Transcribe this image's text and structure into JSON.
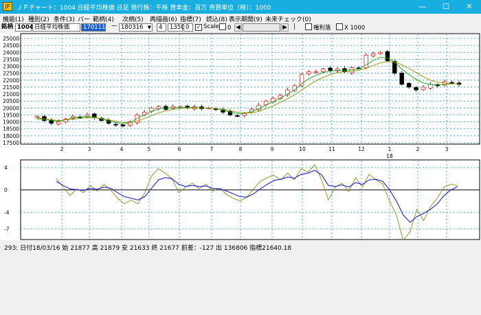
{
  "window": {
    "title": "ＪＰチャート：1004 日経平均株価  日足   発行株：千株  資本金：百万  売買単位（株）：1000",
    "icon_label": "JP",
    "min_icon": "minimize-icon",
    "max_icon": "maximize-icon",
    "close_icon": "close-icon"
  },
  "menu": [
    "機能(1)",
    "種別(2)",
    "条件(3)",
    "バー",
    "範柄(4)",
    "次柄(5)",
    "再描画(6)",
    "指標(7)",
    "読込(8)",
    "表示期間(9)",
    "未来チェック(0)"
  ],
  "toolbar": {
    "label": "銘柄",
    "code": "1004",
    "name": "日経平均株価",
    "date_start": "170111",
    "dash": "一",
    "date_end": "180316",
    "period": "4",
    "value1": "1350",
    "value2": "0",
    "scale_label": "Scale",
    "scale_checked": "✓",
    "zero_label": "0",
    "separator": "|",
    "tick_label": "権利落",
    "x1000_label": "X 1000"
  },
  "chart_data": [
    {
      "type": "candlestick",
      "title": "",
      "ylim": [
        17500,
        25000
      ],
      "yticks": [
        17500,
        18000,
        18500,
        19000,
        19500,
        20000,
        20500,
        21000,
        21500,
        22000,
        22500,
        23000,
        23500,
        24000,
        24500,
        25000
      ],
      "xtick_labels": [
        "2",
        "3",
        "4",
        "5",
        "6",
        "7",
        "8",
        "9",
        "10",
        "11",
        "12",
        "1",
        "2",
        "3"
      ],
      "year_label": "18",
      "grid": true,
      "series": [
        {
          "name": "",
          "values": [
            19400,
            19100,
            18900,
            19000,
            19200,
            19400,
            19350,
            19500,
            19300,
            19100,
            18900,
            18800,
            18700,
            19000,
            19500,
            19700,
            20000,
            20100,
            19900,
            20100,
            20100,
            20000,
            20100,
            19950,
            20000,
            19900,
            19700,
            19500,
            19450,
            19600,
            19900,
            20200,
            20500,
            20700,
            20900,
            21300,
            21600,
            22400,
            22600,
            22600,
            22800,
            22700,
            22800,
            22600,
            22900,
            22850,
            23800,
            23900,
            24000,
            23400,
            22500,
            21700,
            21500,
            21300,
            21500,
            21700,
            21600,
            21900,
            21800,
            21700
          ]
        },
        {
          "name": "",
          "values": [
            19300,
            19200,
            19100,
            19050,
            19150,
            19300,
            19350,
            19400,
            19350,
            19200,
            19050,
            18950,
            18850,
            18950,
            19250,
            19500,
            19750,
            19950,
            20000,
            20000,
            20050,
            20050,
            20050,
            20000,
            20000,
            19950,
            19850,
            19700,
            19600,
            19600,
            19750,
            19950,
            20200,
            20450,
            20700,
            21000,
            21300,
            21750,
            22100,
            22350,
            22550,
            22650,
            22700,
            22700,
            22750,
            22800,
            23100,
            23400,
            23650,
            23600,
            23300,
            22800,
            22400,
            22050,
            21800,
            21700,
            21650,
            21700,
            21750,
            21750
          ]
        },
        {
          "name": "",
          "values": [
            19200,
            19200,
            19150,
            19100,
            19150,
            19200,
            19250,
            19300,
            19300,
            19250,
            19150,
            19050,
            18950,
            18950,
            19050,
            19250,
            19450,
            19650,
            19800,
            19900,
            19950,
            20000,
            20000,
            20000,
            20000,
            19950,
            19900,
            19800,
            19700,
            19650,
            19650,
            19750,
            19950,
            20150,
            20400,
            20650,
            20950,
            21300,
            21650,
            21950,
            22200,
            22400,
            22550,
            22600,
            22650,
            22700,
            22850,
            23050,
            23250,
            23350,
            23300,
            23100,
            22850,
            22550,
            22250,
            22000,
            21850,
            21800,
            21750,
            21750
          ]
        }
      ]
    },
    {
      "type": "line",
      "title": "",
      "ylim": [
        -9,
        5
      ],
      "yticks": [
        4,
        0,
        -4,
        -7
      ],
      "hlines": [
        4,
        0,
        -4,
        -7
      ],
      "grid": true,
      "series": [
        {
          "name": "",
          "values": [
            2,
            0.5,
            -1,
            0.2,
            -0.5,
            0.8,
            -0.2,
            1,
            0,
            -1.5,
            -2.5,
            -1.8,
            -2.5,
            -0.5,
            2.5,
            3.8,
            3,
            2,
            -0.5,
            0.5,
            1.2,
            0.2,
            1,
            -0.2,
            0.3,
            -0.8,
            -1.5,
            -2,
            -1.3,
            0.2,
            1.5,
            2.2,
            2.6,
            1.8,
            3,
            1.8,
            3.8,
            3.2,
            4.5,
            1.8,
            -1.8,
            0.5,
            1.2,
            -0.3,
            2.2,
            0.5,
            2.8,
            1.8,
            1,
            -2,
            -4.5,
            -9,
            -7.5,
            -3.5,
            -5.5,
            -3,
            -1.5,
            0.5,
            1,
            0.8
          ]
        },
        {
          "name": "",
          "values": [
            1.5,
            0.8,
            0.2,
            0,
            -0.1,
            0.3,
            0.1,
            0.5,
            0.3,
            -0.5,
            -1.2,
            -1.5,
            -1.8,
            -1.2,
            0.3,
            1.8,
            2.2,
            2,
            1,
            0.6,
            0.8,
            0.6,
            0.7,
            0.3,
            0.2,
            -0.2,
            -0.7,
            -1.2,
            -1.3,
            -0.7,
            0.2,
            1,
            1.7,
            1.9,
            2.3,
            2.1,
            2.8,
            3,
            3.5,
            2.7,
            0.8,
            0.6,
            0.9,
            0.5,
            1.3,
            1,
            1.8,
            1.9,
            1.5,
            0,
            -2,
            -4.5,
            -5.8,
            -4.8,
            -4.2,
            -3.5,
            -2.5,
            -1,
            0,
            0.6
          ]
        }
      ]
    }
  ],
  "status": {
    "text": "293:  日付18/03/16  始 21877  高 21879  安 21633  終 21677  前差：-127  出 136806  指標21640.18"
  },
  "colors": {
    "titlebar": "#19aee0",
    "grid": "#1aa0b4",
    "ma_red": "#ff2020",
    "ma_green": "#17a017",
    "ma_olive": "#8a9000",
    "osc_olive": "#8a8a1c",
    "osc_blue": "#2020e0",
    "candle": "#000000"
  }
}
